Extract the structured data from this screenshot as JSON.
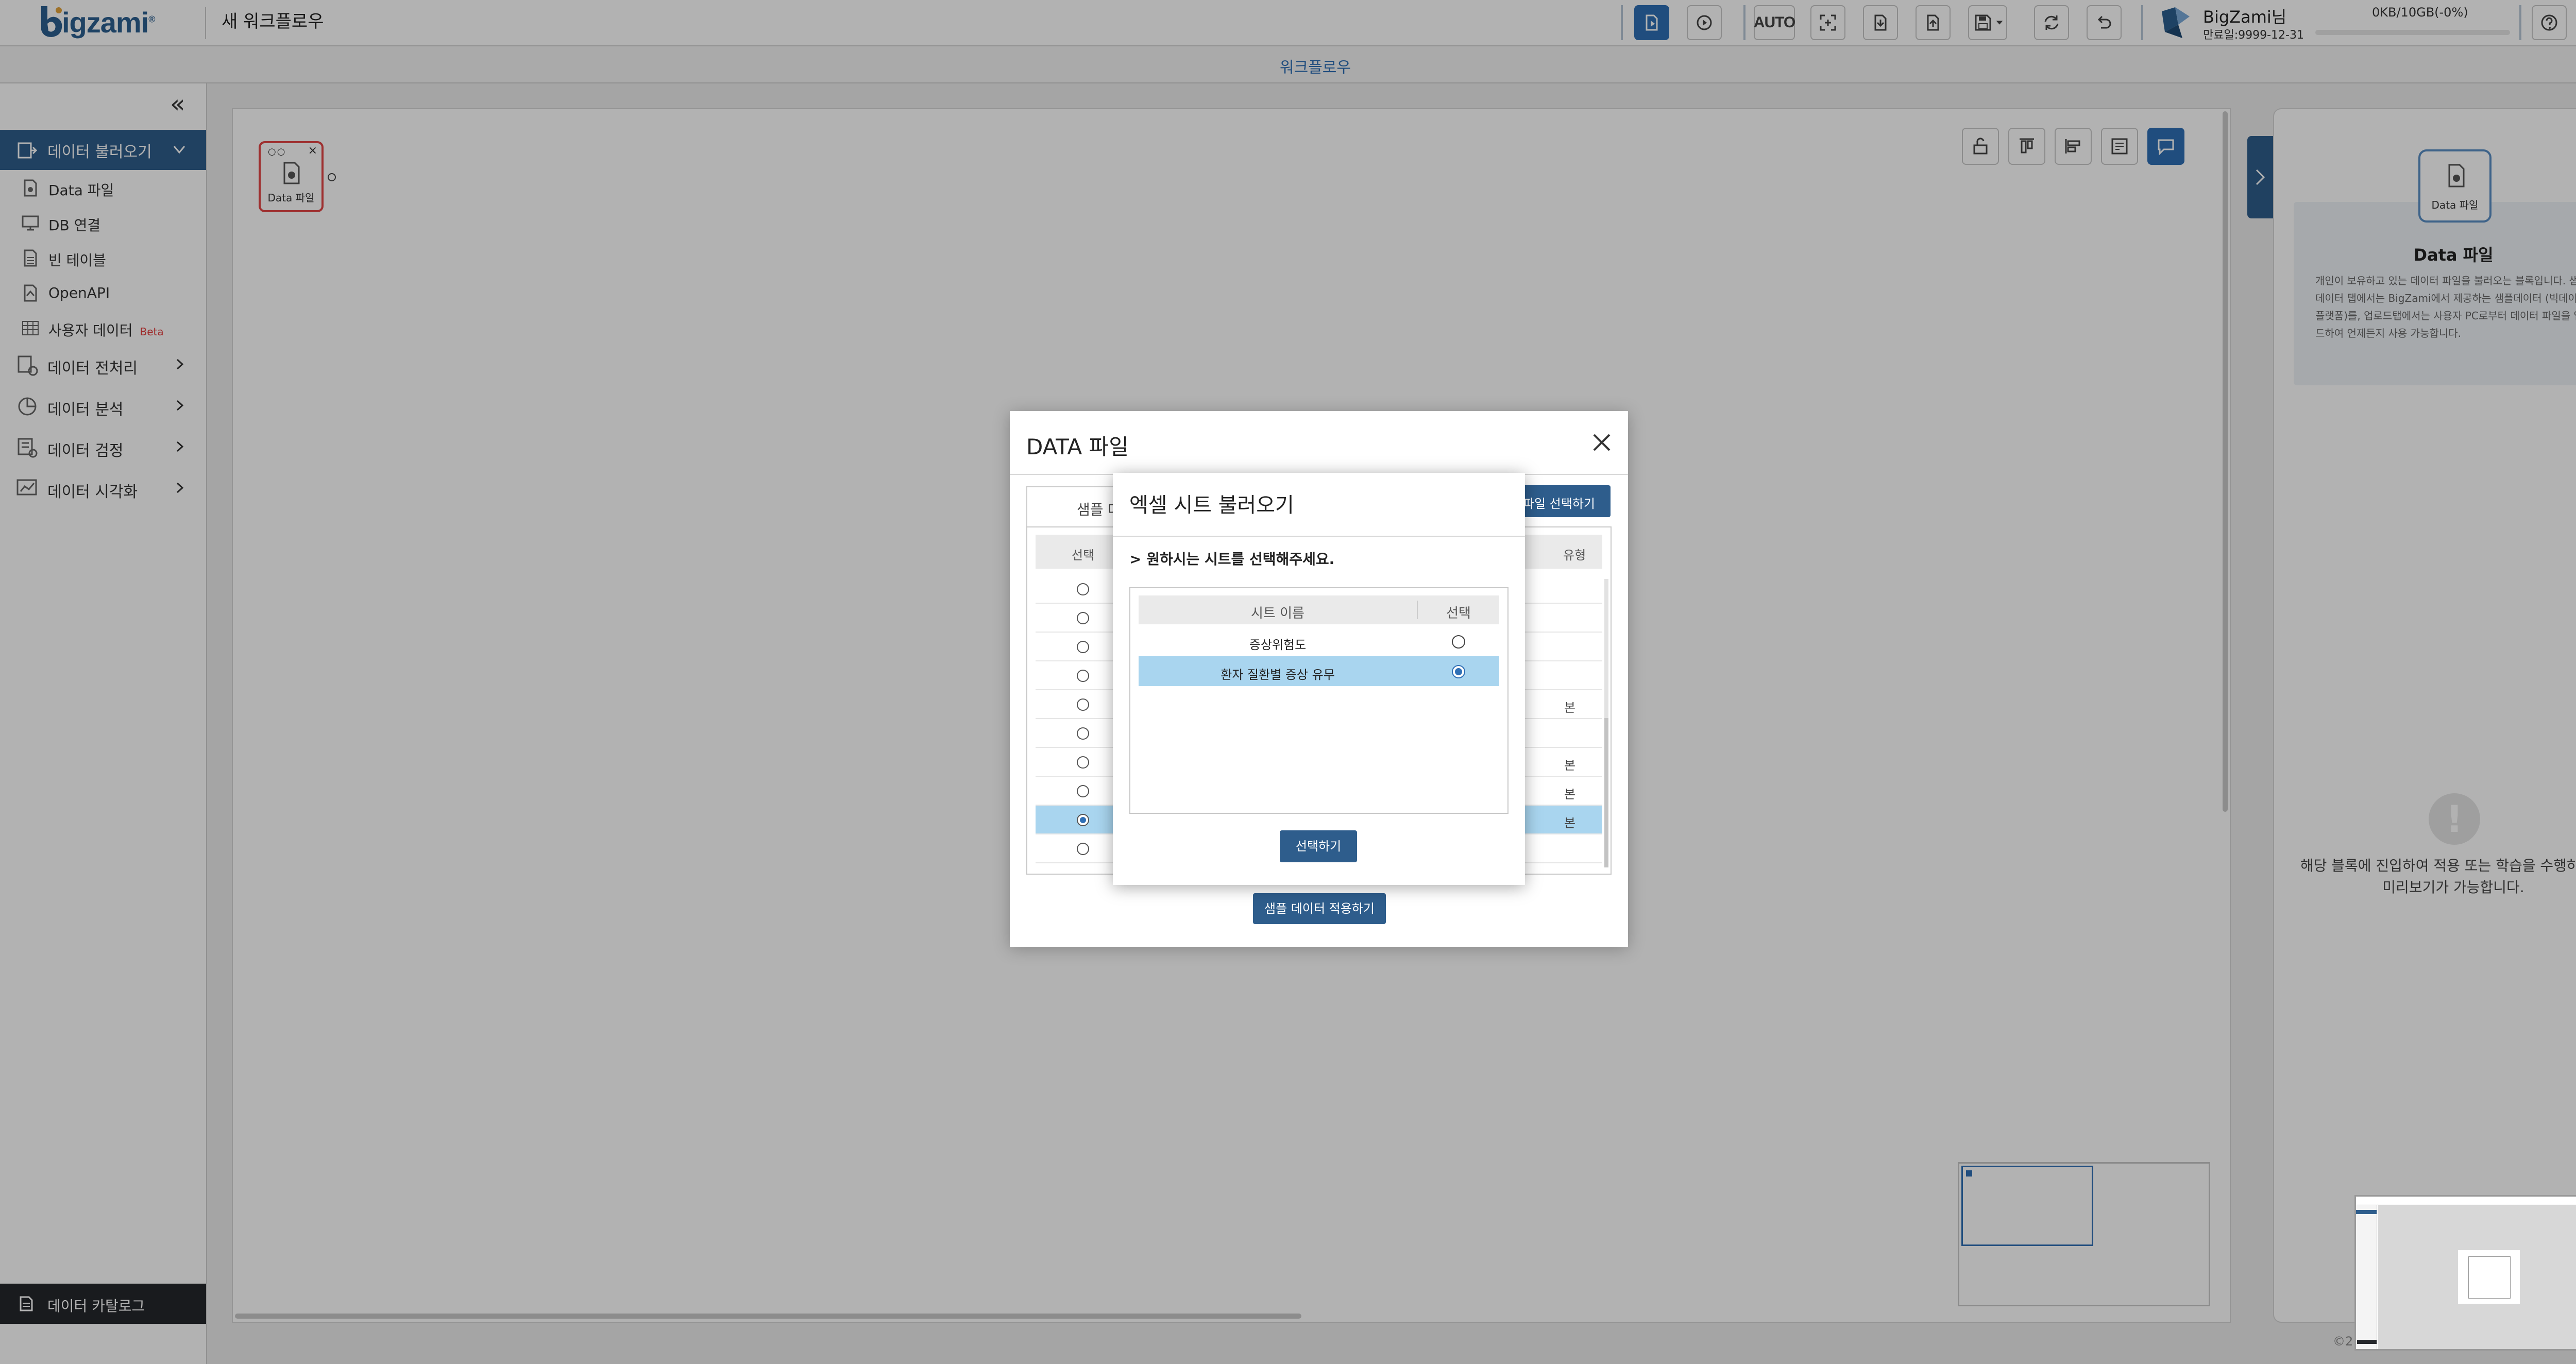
{
  "header": {
    "logo_text": "igzami",
    "logo_reg": "®",
    "workflow_title": "새 워크플로우",
    "auto_label": "AUTO",
    "user_name": "BigZami님",
    "user_expiry": "만료일:9999-12-31",
    "storage": "0KB/10GB(-0%)",
    "storage_percent": 0
  },
  "subheader": {
    "title": "워크플로우"
  },
  "sidebar": {
    "active_menu": "데이터 불러오기",
    "sub_items": [
      {
        "label": "Data 파일",
        "icon": "file-icon"
      },
      {
        "label": "DB 연결",
        "icon": "database-icon"
      },
      {
        "label": "빈 테이블",
        "icon": "table-icon"
      },
      {
        "label": "OpenAPI",
        "icon": "api-icon"
      },
      {
        "label": "사용자 데이터",
        "icon": "grid-icon",
        "badge": "Beta"
      }
    ],
    "menus": [
      {
        "label": "데이터 전처리",
        "icon": "preprocess-icon"
      },
      {
        "label": "데이터 분석",
        "icon": "analysis-icon"
      },
      {
        "label": "데이터 검정",
        "icon": "test-icon"
      },
      {
        "label": "데이터 시각화",
        "icon": "chart-icon"
      }
    ],
    "catalog": "데이터 카탈로그"
  },
  "canvas": {
    "node_label": "Data 파일"
  },
  "right_panel": {
    "icon_label": "Data 파일",
    "title": "Data 파일",
    "description": "개인이 보유하고 있는 데이터 파일을 불러오는 블록입니다. 샘플데이터 탭에서는 BigZami에서 제공하는 샘플데이터 (빅데이터 플랫폼)를, 업로드탭에서는 사용자 PC로부터 데이터 파일을 업로드하여 언제든지 사용 가능합니다.",
    "warning_line1": "해당 블록에 진입하여 적용 또는 학습을 수행하셔야",
    "warning_line2": "미리보기가 가능합니다."
  },
  "dialog_data_file": {
    "title": "DATA 파일",
    "tab_label": "샘플 데이터",
    "pick_button": "파일 선택하기",
    "col_select": "선택",
    "col_type": "유형",
    "rows": [
      {
        "selected": false,
        "type": ""
      },
      {
        "selected": false,
        "type": ""
      },
      {
        "selected": false,
        "type": ""
      },
      {
        "selected": false,
        "type": ""
      },
      {
        "selected": false,
        "type": "본"
      },
      {
        "selected": false,
        "type": ""
      },
      {
        "selected": false,
        "type": "본"
      },
      {
        "selected": false,
        "type": "본"
      },
      {
        "selected": true,
        "type": "본"
      },
      {
        "selected": false,
        "type": ""
      }
    ],
    "apply_button": "샘플 데이터 적용하기"
  },
  "dialog_excel": {
    "title": "엑셀 시트 불러오기",
    "instruction": "> 원하시는 시트를 선택해주세요.",
    "col_name": "시트 이름",
    "col_select": "선택",
    "sheets": [
      {
        "name": "증상위험도",
        "selected": false
      },
      {
        "name": "환자 질환별 증상 유무",
        "selected": true
      }
    ],
    "select_button": "선택하기"
  },
  "footer": {
    "copyright": "©2"
  },
  "colors": {
    "primary": "#2e5d8c",
    "accent": "#2f6fb5",
    "selected_row": "#a9d5ef",
    "node_border": "#e24646"
  }
}
